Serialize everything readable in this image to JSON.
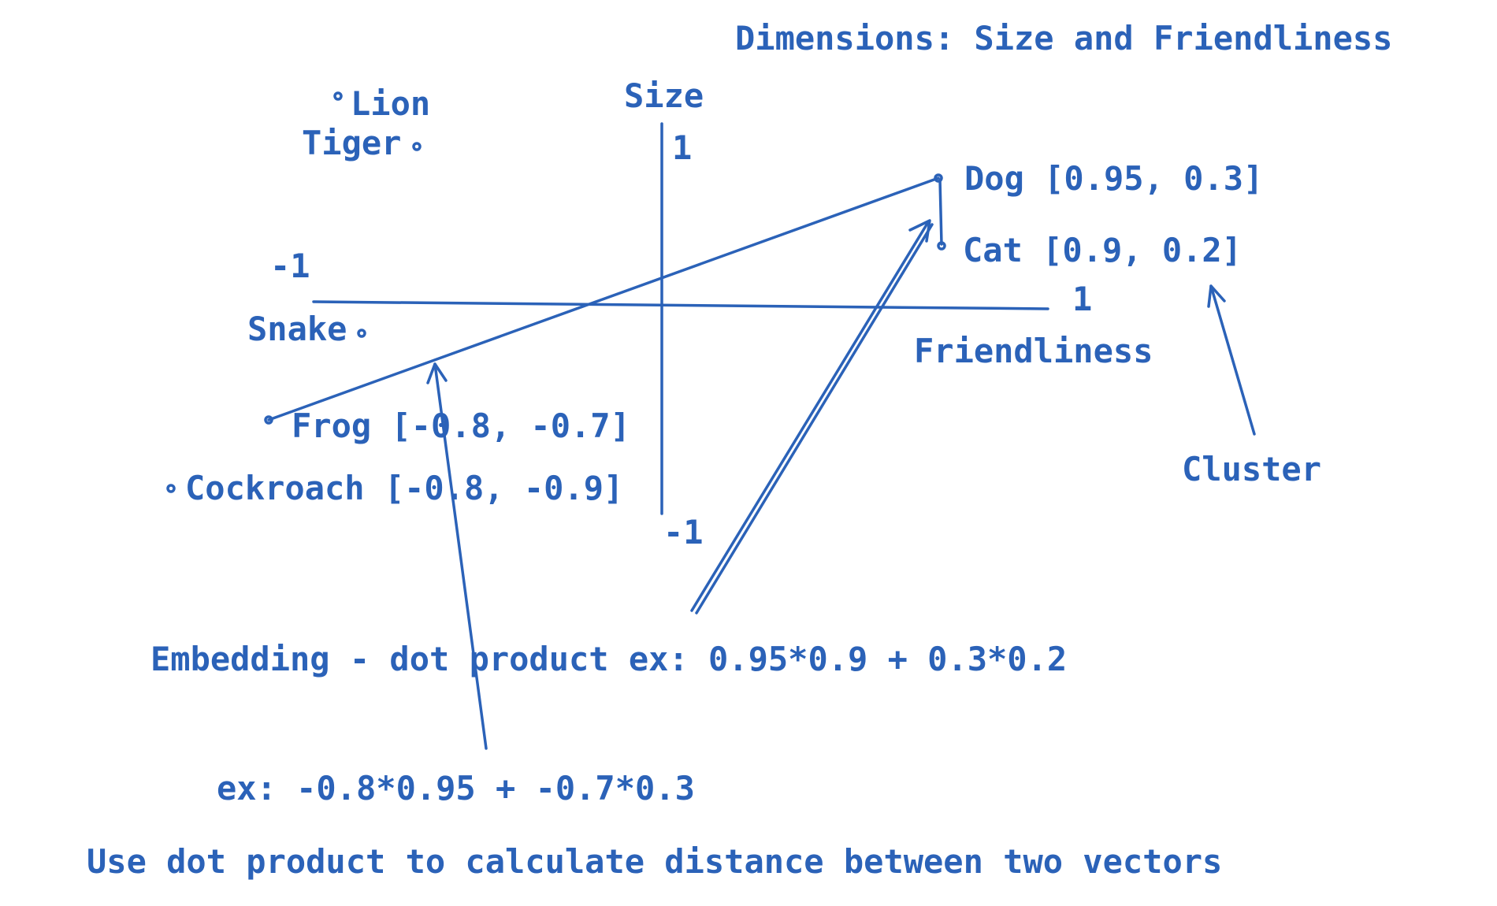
{
  "title": "Dimensions: Size and Friendliness",
  "axes": {
    "vertical_label": "Size",
    "horizontal_label": "Friendliness",
    "v_top_tick": "1",
    "v_bottom_tick": "-1",
    "h_left_tick": "-1",
    "h_right_tick": "1"
  },
  "points": {
    "lion": "Lion",
    "tiger": "Tiger",
    "dog": "Dog [0.95, 0.3]",
    "cat": "Cat [0.9, 0.2]",
    "snake": "Snake",
    "frog": "Frog [-0.8, -0.7]",
    "cockroach": "Cockroach [-0.8, -0.9]"
  },
  "annotations": {
    "cluster": "Cluster",
    "embedding": "Embedding - dot product ex: 0.95*0.9 + 0.3*0.2",
    "example": "ex: -0.8*0.95 + -0.7*0.3",
    "footer": "Use dot product to calculate distance between two vectors"
  },
  "colors": {
    "ink": "#2b62b8"
  }
}
